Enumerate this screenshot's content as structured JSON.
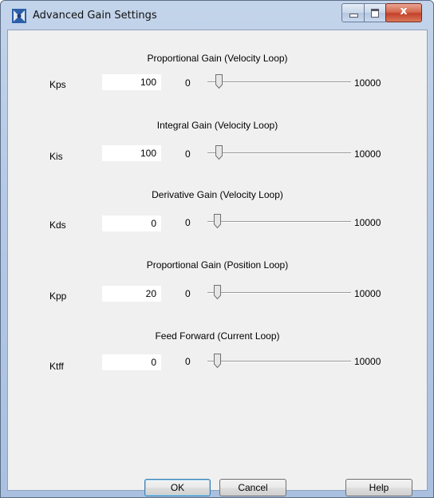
{
  "window": {
    "title": "Advanced Gain Settings",
    "icon": "app-logo-icon",
    "close_glyph": "x"
  },
  "sections": [
    {
      "title": "Proportional Gain (Velocity Loop)",
      "label": "Kps",
      "value": "100",
      "min": "0",
      "max": "10000",
      "slider_value": 100
    },
    {
      "title": "Integral Gain (Velocity Loop)",
      "label": "Kis",
      "value": "100",
      "min": "0",
      "max": "10000",
      "slider_value": 100
    },
    {
      "title": "Derivative Gain (Velocity Loop)",
      "label": "Kds",
      "value": "0",
      "min": "0",
      "max": "10000",
      "slider_value": 0
    },
    {
      "title": "Proportional Gain (Position Loop)",
      "label": "Kpp",
      "value": "20",
      "min": "0",
      "max": "10000",
      "slider_value": 20
    },
    {
      "title": "Feed Forward (Current Loop)",
      "label": "Ktff",
      "value": "0",
      "min": "0",
      "max": "10000",
      "slider_value": 0
    }
  ],
  "buttons": {
    "ok": "OK",
    "cancel": "Cancel",
    "help": "Help"
  }
}
